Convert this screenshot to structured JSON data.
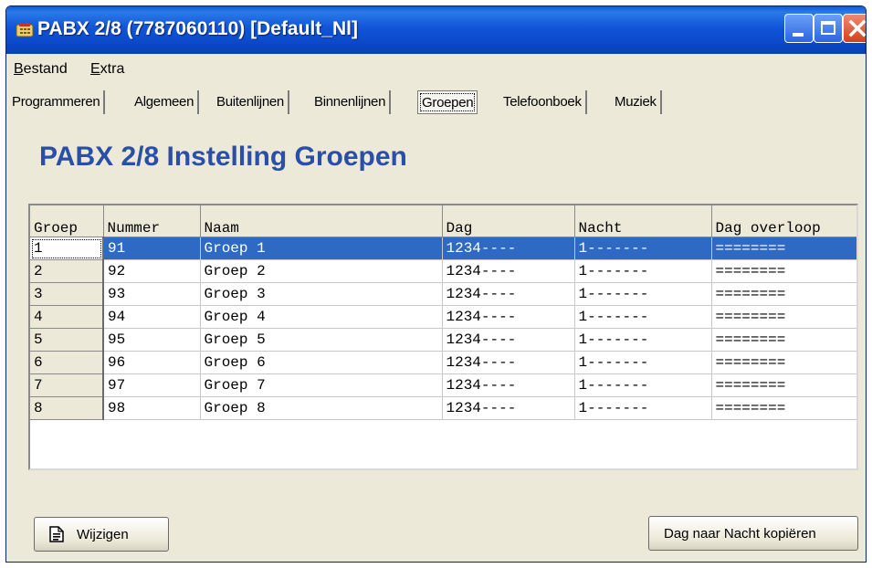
{
  "window": {
    "title": "PABX 2/8 (7787060110) [Default_Nl]"
  },
  "menu": {
    "items": [
      {
        "prefix": "",
        "accel": "B",
        "rest": "estand"
      },
      {
        "prefix": "",
        "accel": "E",
        "rest": "xtra"
      }
    ]
  },
  "tabs": [
    {
      "label": "Programmeren",
      "active": false
    },
    {
      "label": "Algemeen",
      "active": false
    },
    {
      "label": "Buitenlijnen",
      "active": false
    },
    {
      "label": "Binnenlijnen",
      "active": false
    },
    {
      "label": "Groepen",
      "active": true
    },
    {
      "label": "Telefoonboek",
      "active": false
    },
    {
      "label": "Muziek",
      "active": false
    }
  ],
  "page": {
    "title": "PABX 2/8 Instelling Groepen"
  },
  "grid": {
    "columns": [
      "Groep",
      "Nummer",
      "Naam",
      "Dag",
      "Nacht",
      "Dag overloop"
    ],
    "selected_row": 0,
    "rows": [
      [
        "1",
        "91",
        "Groep 1",
        "1234----",
        "1-------",
        "========"
      ],
      [
        "2",
        "92",
        "Groep 2",
        "1234----",
        "1-------",
        "========"
      ],
      [
        "3",
        "93",
        "Groep 3",
        "1234----",
        "1-------",
        "========"
      ],
      [
        "4",
        "94",
        "Groep 4",
        "1234----",
        "1-------",
        "========"
      ],
      [
        "5",
        "95",
        "Groep 5",
        "1234----",
        "1-------",
        "========"
      ],
      [
        "6",
        "96",
        "Groep 6",
        "1234----",
        "1-------",
        "========"
      ],
      [
        "7",
        "97",
        "Groep 7",
        "1234----",
        "1-------",
        "========"
      ],
      [
        "8",
        "98",
        "Groep 8",
        "1234----",
        "1-------",
        "========"
      ]
    ]
  },
  "buttons": {
    "edit_label": "Wijzigen",
    "edit_icon": "document-icon",
    "copy_label": "Dag naar Nacht kopiëren"
  },
  "colors": {
    "title_accent": "#2a4fa8",
    "selection": "#2e6ac4",
    "titlebar": "#0a48c8"
  }
}
